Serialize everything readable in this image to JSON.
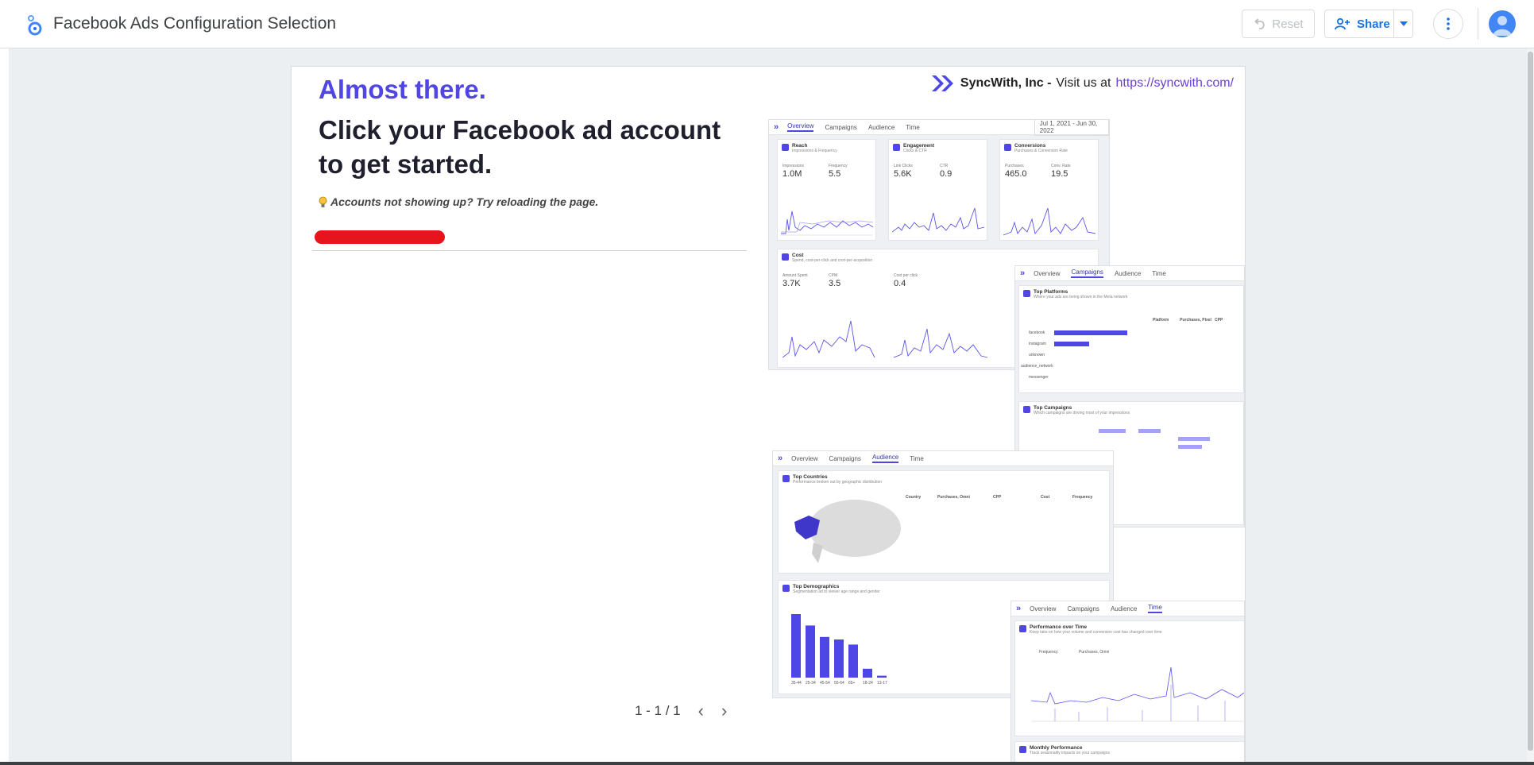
{
  "header": {
    "title": "Facebook Ads Configuration Selection",
    "reset_label": "Reset",
    "share_label": "Share"
  },
  "page": {
    "heading": "Almost there.",
    "subheading": "Click your Facebook ad account to get started.",
    "hint": "Accounts not showing up? Try reloading the page.",
    "company": "SyncWith, Inc -",
    "visit_text": "Visit us at",
    "link": "https://syncwith.com/",
    "pager": "1 - 1 / 1"
  },
  "preview": {
    "tabs": [
      "Overview",
      "Campaigns",
      "Audience",
      "Time"
    ],
    "date_range": "Jul 1, 2021 - Jun 30, 2022",
    "overview_cards": [
      {
        "title": "Reach",
        "sub": "Impressions & Frequency",
        "k1": "Impressions",
        "v1": "1.0M",
        "k2": "Frequency",
        "v2": "5.5"
      },
      {
        "title": "Engagement",
        "sub": "Clicks & CTR",
        "k1": "Link Clicks",
        "v1": "5.6K",
        "k2": "CTR",
        "v2": "0.9"
      },
      {
        "title": "Conversions",
        "sub": "Purchases & Conversion Rate",
        "k1": "Purchases",
        "v1": "465.0",
        "k2": "Conv. Rate",
        "v2": "19.5"
      }
    ],
    "cost_card": {
      "title": "Cost",
      "sub": "Spend, cost-per-click and cost-per-acquisition",
      "k1": "Amount Spent",
      "v1": "3.7K",
      "k2": "CPM",
      "v2": "3.5",
      "k3": "Cost per click",
      "v3": "0.4"
    },
    "top_platforms": {
      "title": "Top Platforms",
      "sub": "Where your ads are being shown in the Meta network",
      "rows": [
        "facebook",
        "instagram",
        "unknown",
        "audience_network",
        "messenger"
      ]
    },
    "top_campaigns": {
      "title": "Top Campaigns",
      "sub": "Which campaigns are driving most of your impressions"
    },
    "top_countries": {
      "title": "Top Countries",
      "sub": "Performance broken out by geographic distribution",
      "cols": [
        "Country",
        "Purchases, Omni",
        "CPP",
        "Cost",
        "Frequency"
      ]
    },
    "top_demographics": {
      "title": "Top Demographics",
      "sub": "Segmentation ad to viewer age range and gender",
      "ages": [
        "35-44",
        "25-34",
        "45-54",
        "55-64",
        "65+",
        "18-24",
        "13-17"
      ],
      "age_values": [
        100,
        82,
        64,
        60,
        52,
        14,
        3
      ]
    },
    "performance_time": {
      "title": "Performance over Time",
      "sub": "Keep tabs on how your volume and conversion cost has changed over time",
      "legend1": "Frequency",
      "legend2": "Purchases, Omni"
    },
    "monthly": {
      "title": "Monthly Performance",
      "sub": "Track seasonality impacts on your campaigns"
    }
  }
}
